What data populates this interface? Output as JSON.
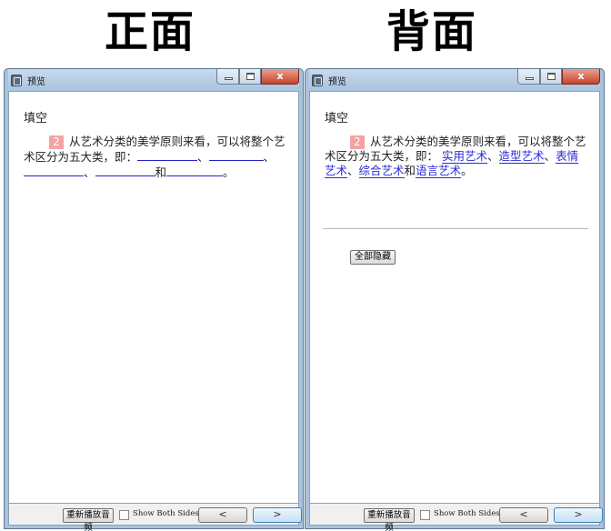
{
  "labels": {
    "front": "正面",
    "back": "背面"
  },
  "window": {
    "title": "预览",
    "close_glyph": "x"
  },
  "card": {
    "type": "填空",
    "number": "2",
    "question_line1": "从艺术分类的美学原则来看，可以将",
    "question_line2": "整个艺术区分为五大类，即：",
    "conj_and": "和",
    "sep": "、",
    "period": "。",
    "answers": [
      "实用艺术",
      "造型艺术",
      "表情艺术",
      "综合艺术",
      "语言艺术"
    ]
  },
  "back_controls": {
    "hide_all": "全部隐藏"
  },
  "bottom": {
    "replay": "重新播放音频",
    "show_both": "Show Both Sides",
    "prev": "<",
    "next": ">"
  }
}
